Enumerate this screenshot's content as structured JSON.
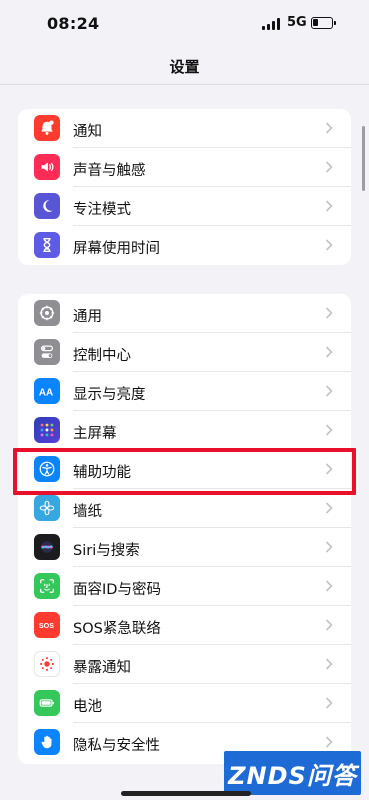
{
  "status": {
    "time": "08:24",
    "network": "5G"
  },
  "nav": {
    "title": "设置"
  },
  "groups": [
    {
      "items": [
        {
          "label": "通知",
          "icon": "bell-icon",
          "color": "#ff3b30"
        },
        {
          "label": "声音与触感",
          "icon": "speaker-icon",
          "color": "#ff2d55"
        },
        {
          "label": "专注模式",
          "icon": "moon-icon",
          "color": "#5856d6"
        },
        {
          "label": "屏幕使用时间",
          "icon": "hourglass-icon",
          "color": "#5e5ce6"
        }
      ]
    },
    {
      "items": [
        {
          "label": "通用",
          "icon": "gear-icon",
          "color": "#8e8e93"
        },
        {
          "label": "控制中心",
          "icon": "toggles-icon",
          "color": "#8e8e93"
        },
        {
          "label": "显示与亮度",
          "icon": "text-size-icon",
          "color": "#0a84ff"
        },
        {
          "label": "主屏幕",
          "icon": "home-grid-icon",
          "color": "#3a4bd6"
        },
        {
          "label": "辅助功能",
          "icon": "accessibility-icon",
          "color": "#0a84ff"
        },
        {
          "label": "墙纸",
          "icon": "flower-icon",
          "color": "#36a7e0"
        },
        {
          "label": "Siri与搜索",
          "icon": "siri-icon",
          "color": "#222222"
        },
        {
          "label": "面容ID与密码",
          "icon": "faceid-icon",
          "color": "#34c759"
        },
        {
          "label": "SOS紧急联络",
          "icon": "sos-icon",
          "color": "#ff3b30"
        },
        {
          "label": "暴露通知",
          "icon": "exposure-icon",
          "color": "#ffffff"
        },
        {
          "label": "电池",
          "icon": "battery-icon",
          "color": "#34c759"
        },
        {
          "label": "隐私与安全性",
          "icon": "hand-icon",
          "color": "#0a84ff"
        }
      ]
    }
  ],
  "watermark": "ZNDS问答"
}
